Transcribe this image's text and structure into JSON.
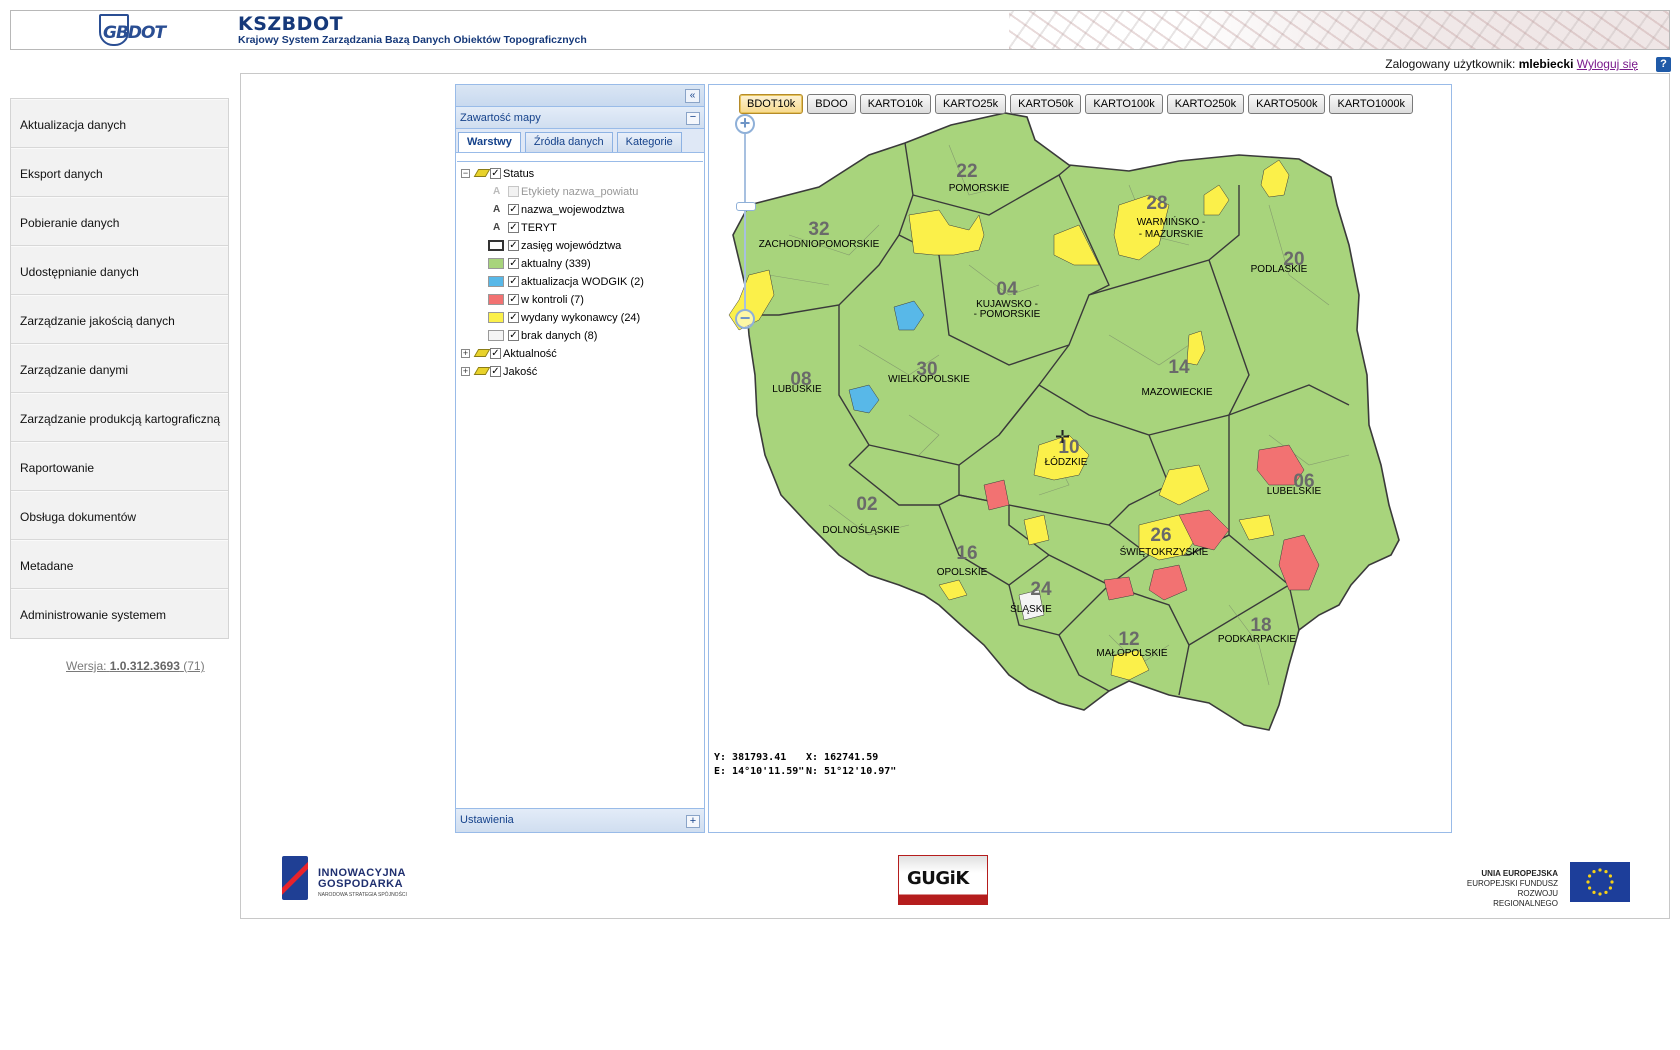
{
  "header": {
    "logo_text": "GBDOT",
    "title": "KSZBDOT",
    "subtitle": "Krajowy System Zarządzania Bazą Danych Obiektów Topograficznych"
  },
  "user": {
    "label": "Zalogowany użytkownik:",
    "name": "mlebiecki",
    "logout": "Wyloguj się",
    "help": "?"
  },
  "sidebar": {
    "items": [
      {
        "label": "Aktualizacja danych"
      },
      {
        "label": "Eksport danych"
      },
      {
        "label": "Pobieranie danych"
      },
      {
        "label": "Udostępnianie danych"
      },
      {
        "label": "Zarządzanie jakością danych"
      },
      {
        "label": "Zarządzanie danymi"
      },
      {
        "label": "Zarządzanie produkcją kartograficzną"
      },
      {
        "label": "Raportowanie"
      },
      {
        "label": "Obsługa dokumentów"
      },
      {
        "label": "Metadane"
      },
      {
        "label": "Administrowanie systemem"
      }
    ],
    "version_label": "Wersja:",
    "version": "1.0.312.3693",
    "version_extra": "(71)"
  },
  "panel": {
    "collapse": "«",
    "title": "Zawartość mapy",
    "tabs": [
      "Warstwy",
      "Źródła danych",
      "Kategorie"
    ],
    "tree": {
      "status": "Status",
      "etykiety": "Etykiety nazwa_powiatu",
      "nazwa": "nazwa_wojewodztwa",
      "teryt": "TERYT",
      "zasieg": "zasięg województwa",
      "aktualny": "aktualny (339)",
      "wodgik": "aktualizacja WODGIK (2)",
      "kontrola": "w kontroli (7)",
      "wydany": "wydany wykonawcy (24)",
      "brak": "brak danych (8)",
      "aktualnosc": "Aktualność",
      "jakosc": "Jakość"
    },
    "footer": "Ustawienia"
  },
  "colors": {
    "aktualny": "#a8d47c",
    "wodgik": "#58b8e8",
    "kontrola": "#f27272",
    "wydany": "#fbf04a",
    "brak": "#f4f4f4"
  },
  "map": {
    "scales": [
      "BDOT10k",
      "BDOO",
      "KARTO10k",
      "KARTO25k",
      "KARTO50k",
      "KARTO100k",
      "KARTO250k",
      "KARTO500k",
      "KARTO1000k"
    ],
    "coords": {
      "y": "Y: 381793.41",
      "x": "X: 162741.59",
      "e": "E: 14°10'11.59\"",
      "n": "N: 51°12'10.97\""
    },
    "regions": [
      {
        "num": "22",
        "name": "POMORSKIE"
      },
      {
        "num": "28",
        "name": "WARMIŃSKO -"
      },
      {
        "num": "",
        "name": "- MAZURSKIE"
      },
      {
        "num": "32",
        "name": "ZACHODNIOPOMORSKIE"
      },
      {
        "num": "20",
        "name": "PODLASKIE"
      },
      {
        "num": "04",
        "name": "KUJAWSKO -"
      },
      {
        "num": "",
        "name": "- POMORSKIE"
      },
      {
        "num": "30",
        "name": "WIELKOPOLSKIE"
      },
      {
        "num": "14",
        "name": "MAZOWIECKIE"
      },
      {
        "num": "08",
        "name": "LUBUSKIE"
      },
      {
        "num": "10",
        "name": "ŁÓDZKIE"
      },
      {
        "num": "06",
        "name": "LUBELSKIE"
      },
      {
        "num": "02",
        "name": "DOLNOŚLĄSKIE"
      },
      {
        "num": "26",
        "name": "ŚWIĘTOKRZYSKIE"
      },
      {
        "num": "16",
        "name": "OPOLSKIE"
      },
      {
        "num": "24",
        "name": "ŚLĄSKIE"
      },
      {
        "num": "18",
        "name": "PODKARPACKIE"
      },
      {
        "num": "12",
        "name": "MAŁOPOLSKIE"
      }
    ]
  },
  "footer_logos": {
    "ig_line1": "INNOWACYJNA",
    "ig_line2": "GOSPODARKA",
    "ig_line3": "NARODOWA STRATEGIA SPÓJNOŚCI",
    "gugik": "GUGiK",
    "ue_line1": "UNIA EUROPEJSKA",
    "ue_line2": "EUROPEJSKI FUNDUSZ",
    "ue_line3": "ROZWOJU REGIONALNEGO"
  }
}
